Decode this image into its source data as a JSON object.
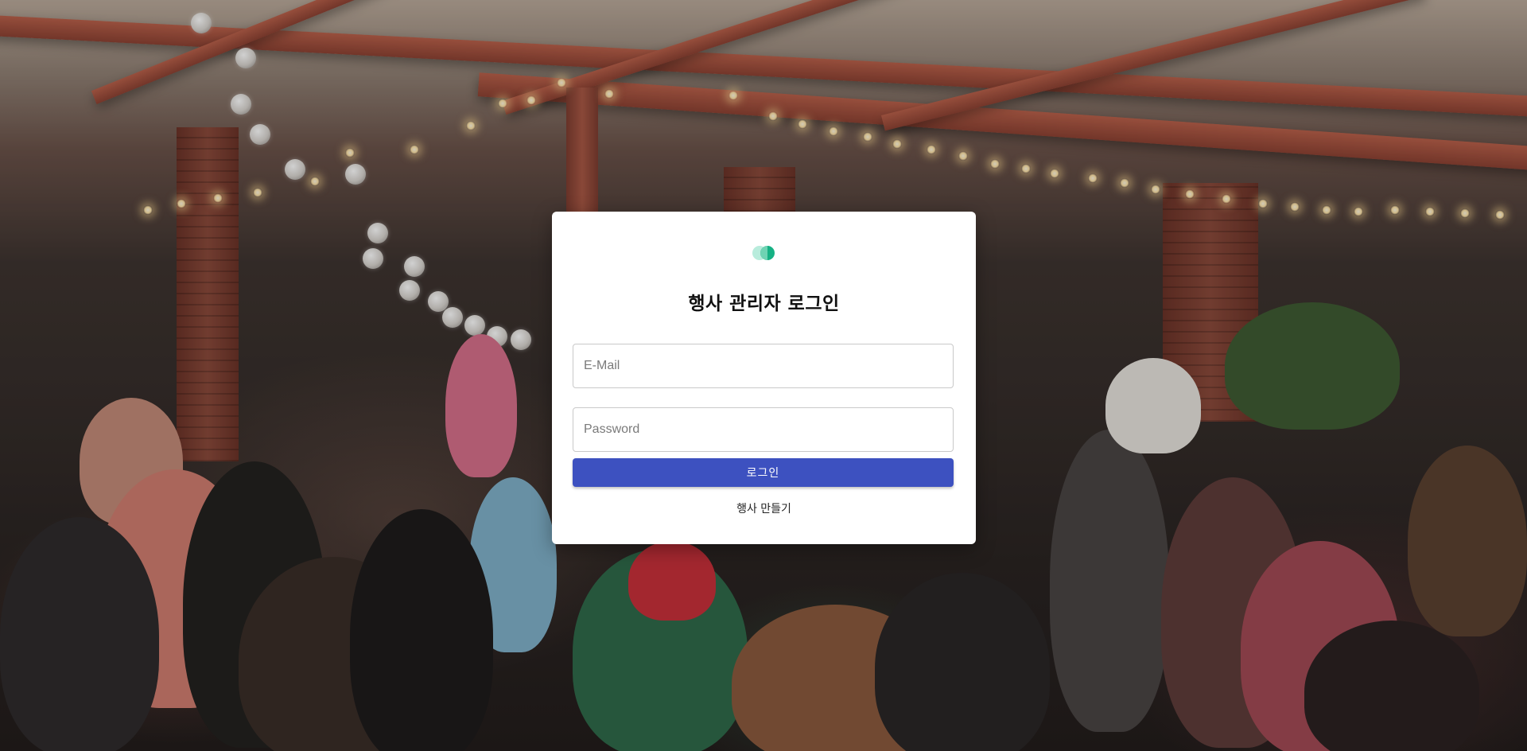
{
  "background": {
    "description_icon": "party-crowd-photo"
  },
  "login_card": {
    "logo_icon": "two-circle-logo-icon",
    "title": "행사 관리자 로그인",
    "email": {
      "placeholder": "E-Mail",
      "value": ""
    },
    "password": {
      "placeholder": "Password",
      "value": ""
    },
    "login_button_label": "로그인",
    "create_event_link": "행사 만들기"
  },
  "colors": {
    "primary_button": "#3d51c0",
    "logo_teal": "#16b184",
    "logo_light": "#b8ecdc"
  }
}
